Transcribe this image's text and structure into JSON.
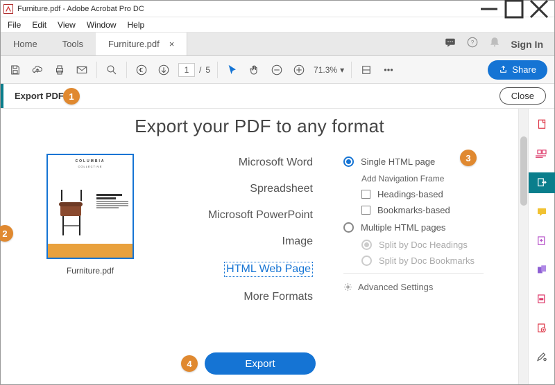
{
  "window": {
    "title": "Furniture.pdf - Adobe Acrobat Pro DC"
  },
  "menu": {
    "items": [
      "File",
      "Edit",
      "View",
      "Window",
      "Help"
    ]
  },
  "tabs": {
    "home": "Home",
    "tools": "Tools",
    "doc": "Furniture.pdf",
    "signin": "Sign In"
  },
  "toolbar": {
    "page_current": "1",
    "page_sep": "/",
    "page_total": "5",
    "zoom": "71.3%",
    "share": "Share"
  },
  "export_header": {
    "label": "Export PDF",
    "close": "Close"
  },
  "callouts": {
    "c1": "1",
    "c2": "2",
    "c3": "3",
    "c4": "4"
  },
  "page": {
    "title": "Export your PDF to any format"
  },
  "thumb": {
    "brand": "COLUMBIA",
    "sub": "COLLECTIVE",
    "filename": "Furniture.pdf"
  },
  "formats": {
    "word": "Microsoft Word",
    "spreadsheet": "Spreadsheet",
    "ppt": "Microsoft PowerPoint",
    "image": "Image",
    "html": "HTML Web Page",
    "more": "More Formats"
  },
  "options": {
    "single": "Single HTML page",
    "navframe": "Add Navigation Frame",
    "headings_based": "Headings-based",
    "bookmarks_based": "Bookmarks-based",
    "multiple": "Multiple HTML pages",
    "split_headings": "Split by Doc Headings",
    "split_bookmarks": "Split by Doc Bookmarks",
    "advanced": "Advanced Settings"
  },
  "export_btn": "Export"
}
